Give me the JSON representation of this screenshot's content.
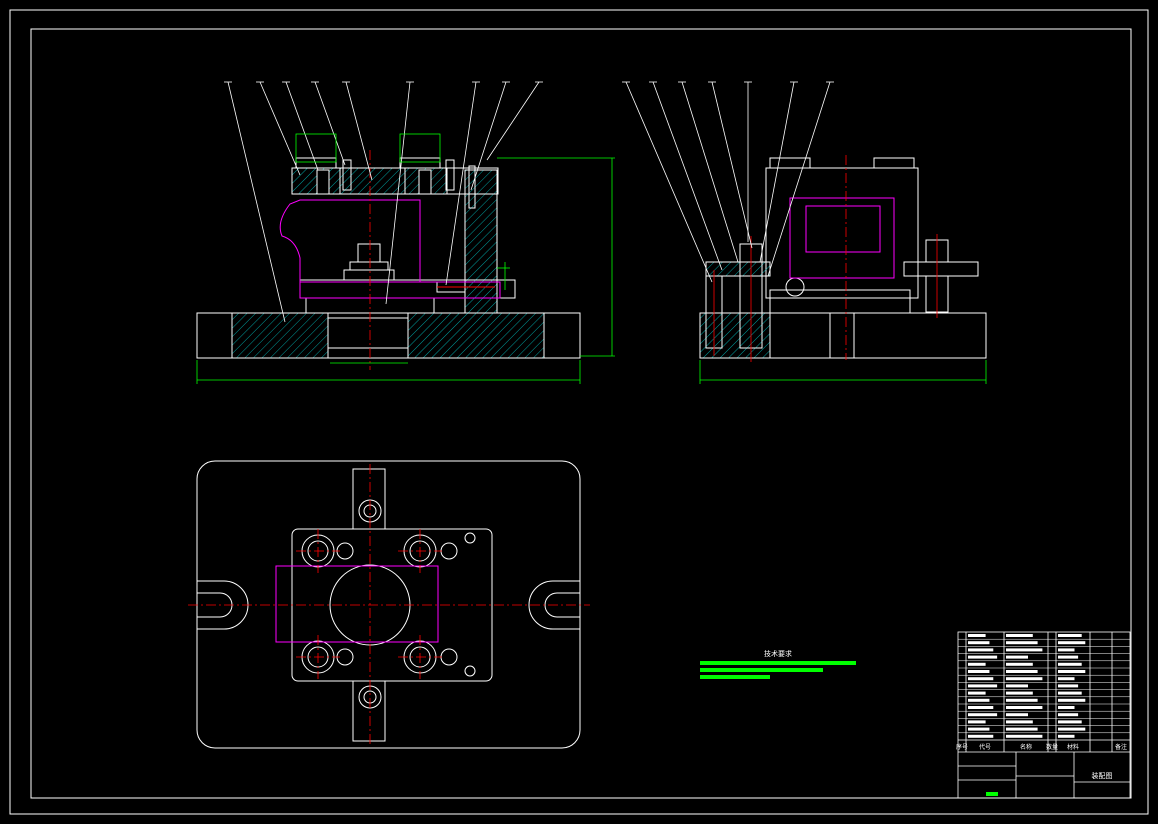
{
  "drawing": {
    "background": "#000000",
    "colors": {
      "outline": "#ffffff",
      "center_line": "#ff0000",
      "hidden_part": "#ff00ff",
      "dimension": "#00ff00",
      "hatch": "#00ffff"
    }
  },
  "notes": {
    "title": "技术要求",
    "lines_color": "#00ff00"
  },
  "title_block": {
    "name_cell": "装配图",
    "header": [
      "序号",
      "代号",
      "名称",
      "数量",
      "材料",
      "备注"
    ]
  }
}
